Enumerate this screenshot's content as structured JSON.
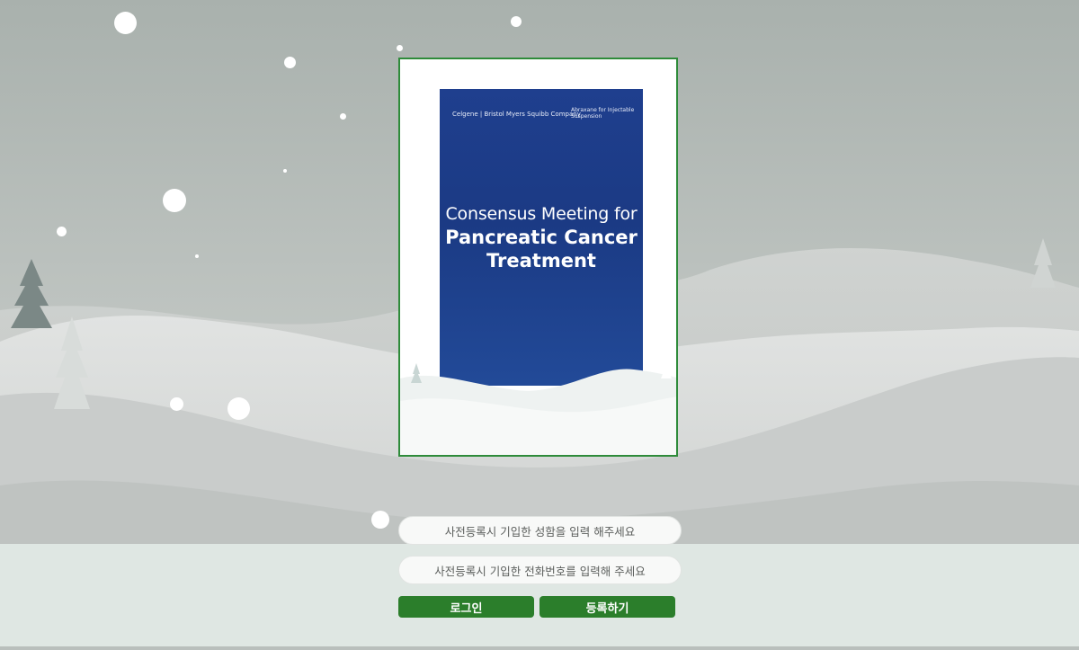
{
  "poster": {
    "logo_left": "Celgene | Bristol Myers Squibb Company",
    "logo_right": "Abraxane for Injectable Suspension",
    "title_line1": "Consensus Meeting for",
    "title_line2": "Pancreatic Cancer",
    "title_line3": "Treatment"
  },
  "form": {
    "name_placeholder": "사전등록시 기입한 성함을 입력 해주세요",
    "phone_placeholder": "사전등록시 기입한 전화번호를 입력해 주세요",
    "login_label": "로그인",
    "register_label": "등록하기"
  },
  "colors": {
    "accent": "#2b7e2b",
    "poster_blue": "#1f3f8e",
    "frame_border": "#2e8b3a"
  }
}
